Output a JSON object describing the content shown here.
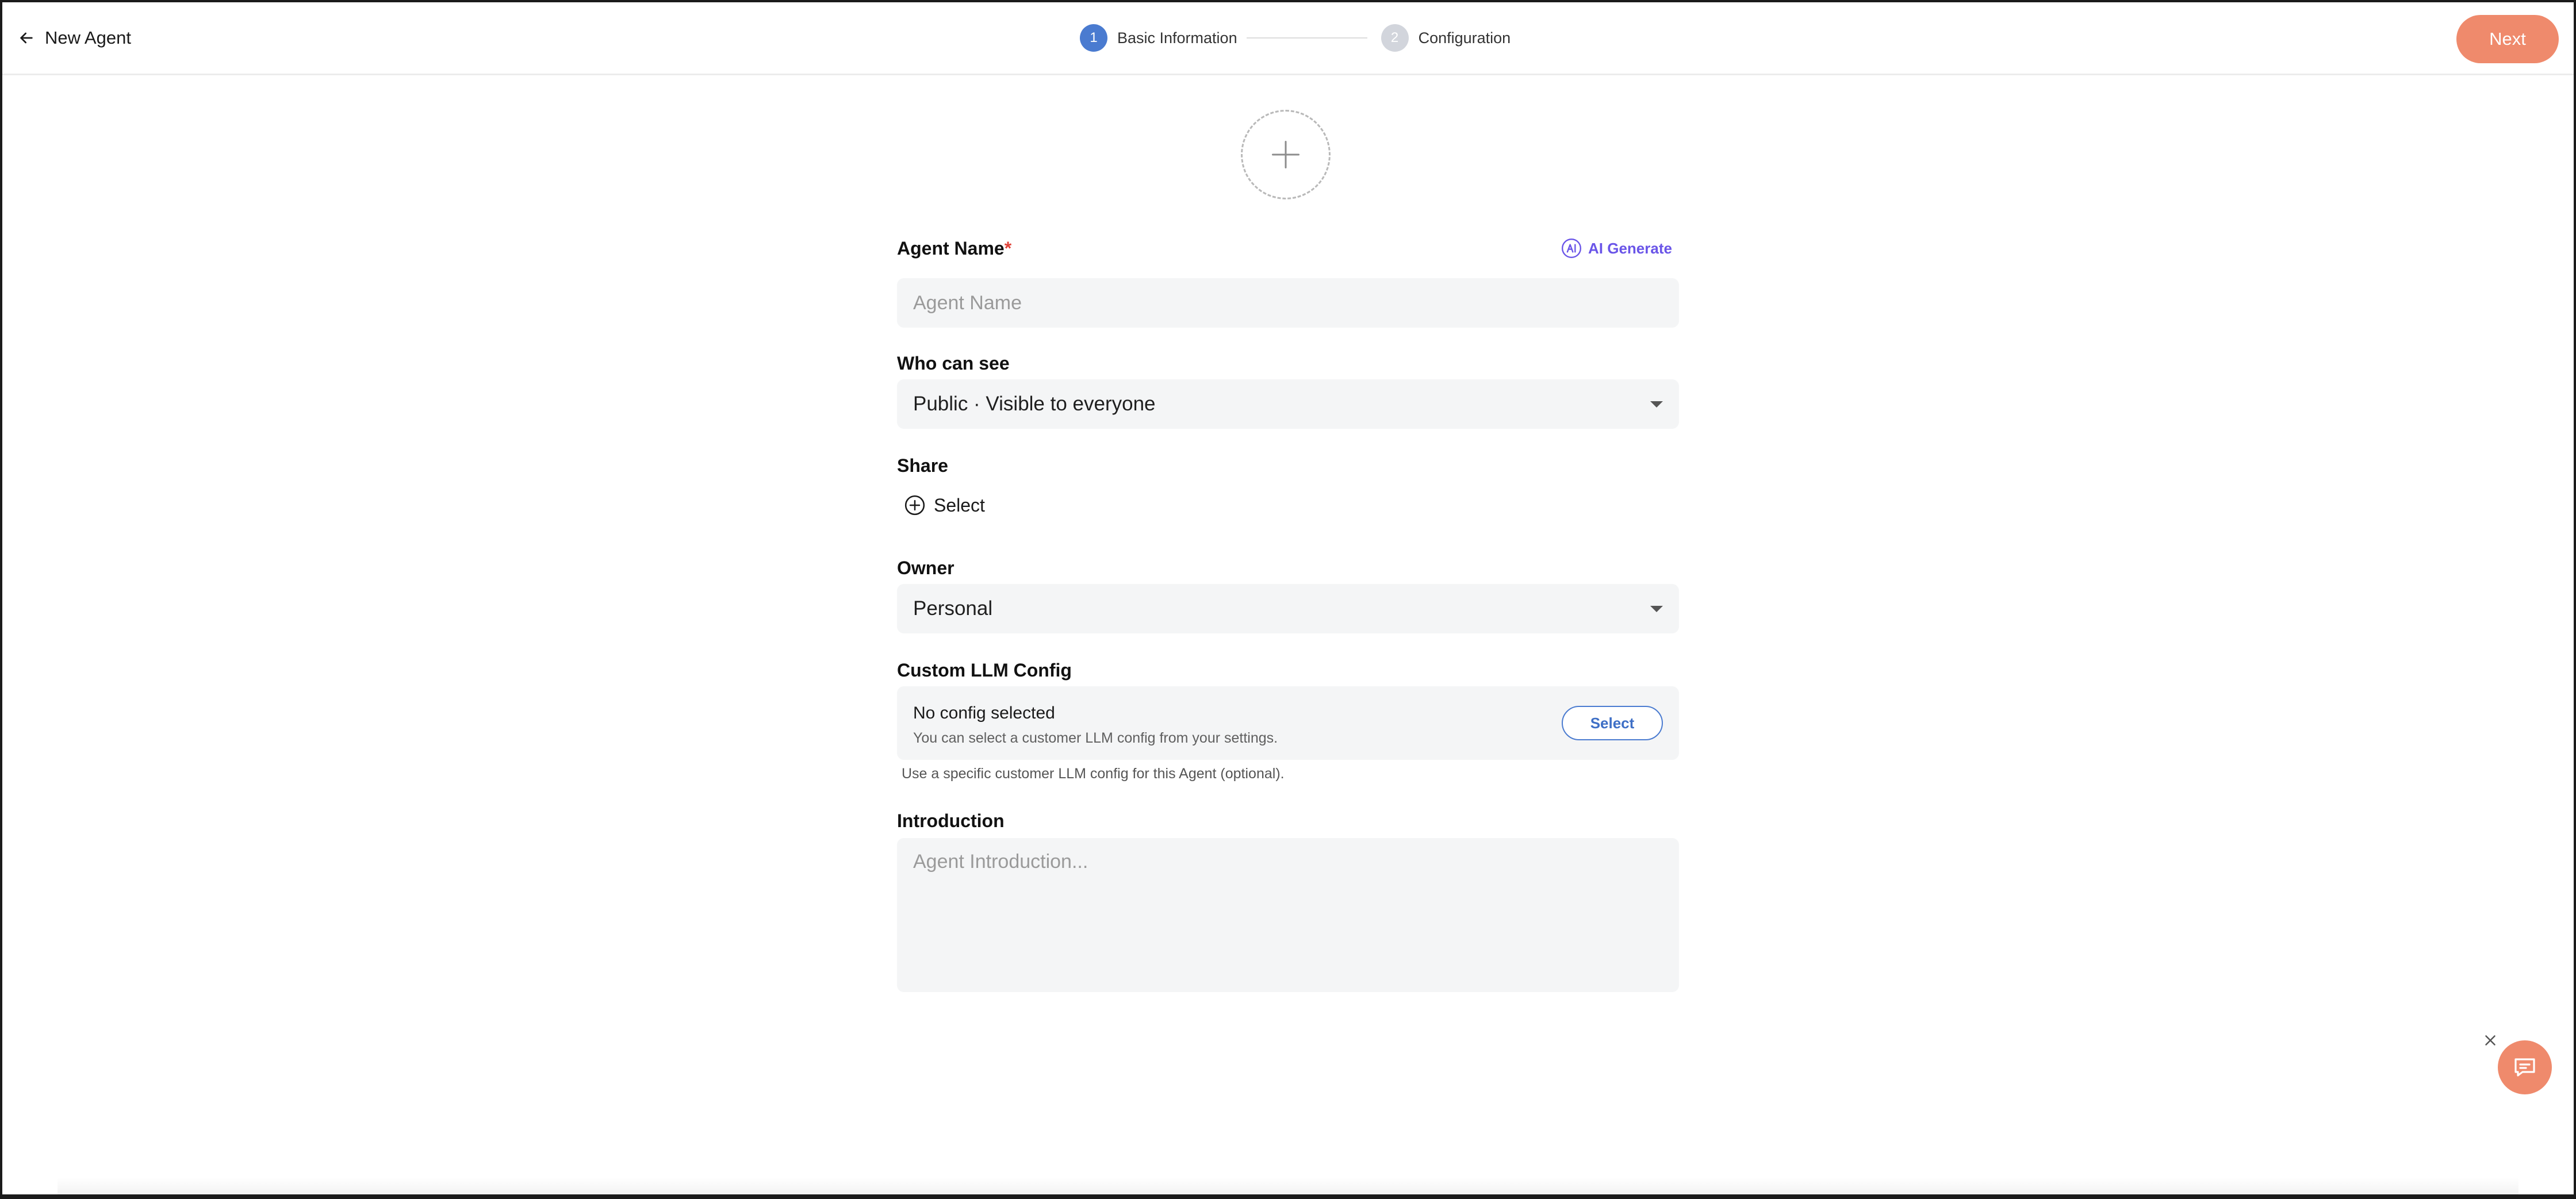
{
  "header": {
    "back_label": "New Agent",
    "steps": [
      {
        "number": "1",
        "label": "Basic Information"
      },
      {
        "number": "2",
        "label": "Configuration"
      }
    ],
    "next_label": "Next"
  },
  "form": {
    "agent_name": {
      "label": "Agent Name",
      "required_mark": "*",
      "placeholder": "Agent Name",
      "value": "",
      "ai_generate_label": "AI Generate"
    },
    "visibility": {
      "label": "Who can see",
      "selected": "Public · Visible to everyone"
    },
    "share": {
      "label": "Share",
      "select_label": "Select"
    },
    "owner": {
      "label": "Owner",
      "selected": "Personal"
    },
    "llm_config": {
      "label": "Custom LLM Config",
      "status": "No config selected",
      "description": "You can select a customer LLM config from your settings.",
      "select_label": "Select",
      "hint": "Use a specific customer LLM config for this Agent (optional)."
    },
    "introduction": {
      "label": "Introduction",
      "placeholder": "Agent Introduction...",
      "value": ""
    }
  },
  "colors": {
    "accent": "#ef8a6c",
    "primary": "#4a7bd0",
    "ai": "#6a55e8",
    "field_bg": "#f4f5f6",
    "required": "#e0443a"
  },
  "icons": {
    "back": "arrow-left-icon",
    "avatar": "plus-icon",
    "ai": "ai-icon",
    "share": "plus-circle-icon",
    "chat": "chat-icon",
    "close": "close-icon"
  }
}
